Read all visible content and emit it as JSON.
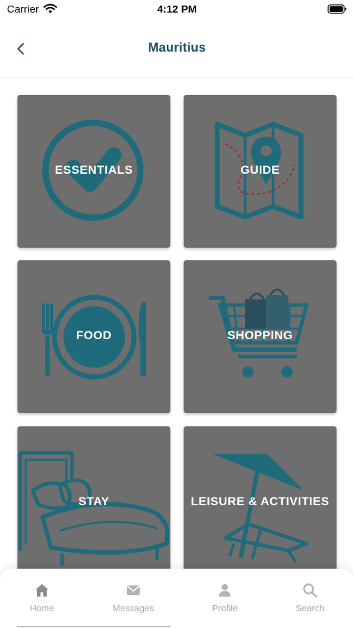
{
  "status_bar": {
    "carrier": "Carrier",
    "time": "4:12 PM"
  },
  "nav": {
    "title": "Mauritius",
    "back_icon": "chevron-left-icon"
  },
  "tiles": [
    {
      "label": "ESSENTIALS",
      "icon": "check-circle-icon"
    },
    {
      "label": "GUIDE",
      "icon": "map-pin-icon"
    },
    {
      "label": "FOOD",
      "icon": "plate-cutlery-icon"
    },
    {
      "label": "SHOPPING",
      "icon": "shopping-cart-icon"
    },
    {
      "label": "STAY",
      "icon": "bed-icon"
    },
    {
      "label": "LEISURE & ACTIVITIES",
      "icon": "beach-chair-icon"
    }
  ],
  "tabs": [
    {
      "label": "Home",
      "icon": "home-icon"
    },
    {
      "label": "Messages",
      "icon": "envelope-icon"
    },
    {
      "label": "Profile",
      "icon": "user-icon"
    },
    {
      "label": "Search",
      "icon": "search-icon"
    }
  ],
  "colors": {
    "accent": "#1d4f63",
    "icon_teal": "#1f6a7b",
    "tile_bg": "#6e6e6e",
    "tab_inactive": "#a5a5a5"
  }
}
